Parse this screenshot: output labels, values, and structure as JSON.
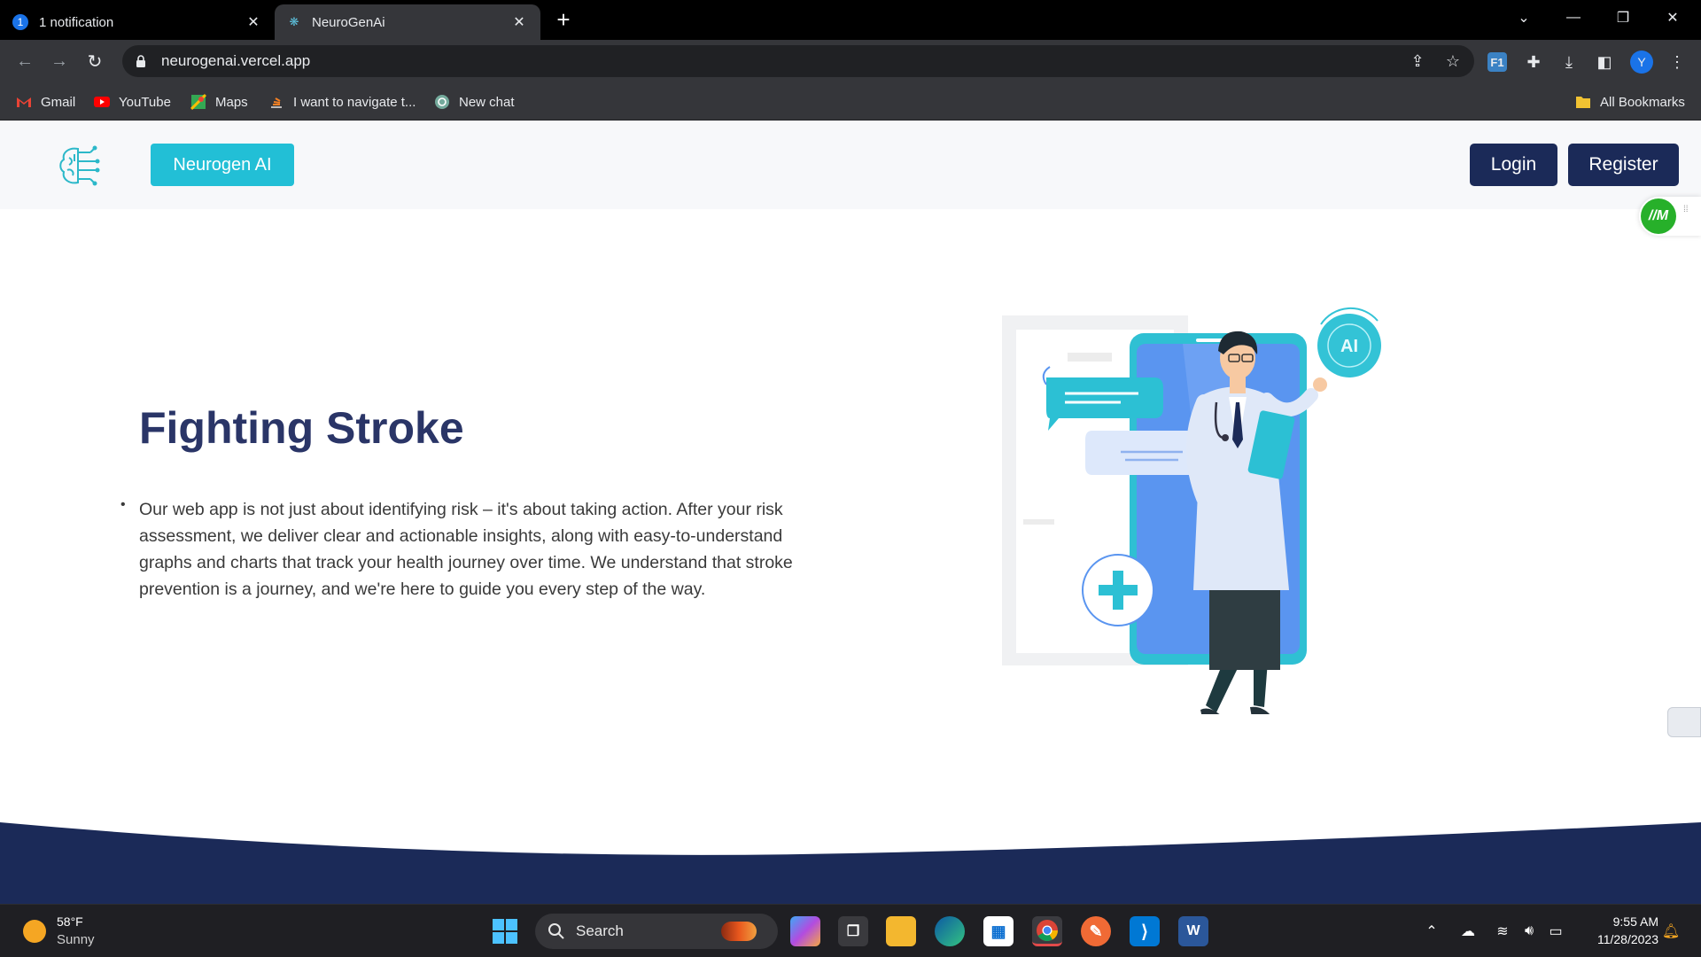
{
  "browser": {
    "tabs": [
      {
        "title": "1 notification",
        "badge": "1",
        "active": false
      },
      {
        "title": "NeuroGenAi",
        "active": true
      }
    ],
    "url": "neurogenai.vercel.app",
    "profile_initial": "Y",
    "extension_label": "F1",
    "bookmarks": [
      {
        "label": "Gmail",
        "icon": "gmail-icon"
      },
      {
        "label": "YouTube",
        "icon": "youtube-icon"
      },
      {
        "label": "Maps",
        "icon": "maps-icon"
      },
      {
        "label": "I want to navigate t...",
        "icon": "stack-icon"
      },
      {
        "label": "New chat",
        "icon": "chatgpt-icon"
      }
    ],
    "all_bookmarks": "All Bookmarks"
  },
  "site": {
    "brand_label": "Neurogen AI",
    "login_label": "Login",
    "register_label": "Register",
    "widget_label": "//M",
    "hero": {
      "title": "Fighting Stroke",
      "bullet": "•",
      "body": "Our web app is not just about identifying risk – it's about taking action. After your risk assessment, we deliver clear and actionable insights, along with easy-to-understand graphs and charts that track your health journey over time. We understand that stroke prevention is a journey, and we're here to guide you every step of the way."
    },
    "illustration_badge": "AI",
    "colors": {
      "accent": "#22bfd6",
      "navy": "#1b2a58",
      "title": "#2a3567",
      "wave": "#1b2a58"
    }
  },
  "taskbar": {
    "temperature": "58°F",
    "condition": "Sunny",
    "search_label": "Search",
    "time": "9:55 AM",
    "date": "11/28/2023"
  }
}
